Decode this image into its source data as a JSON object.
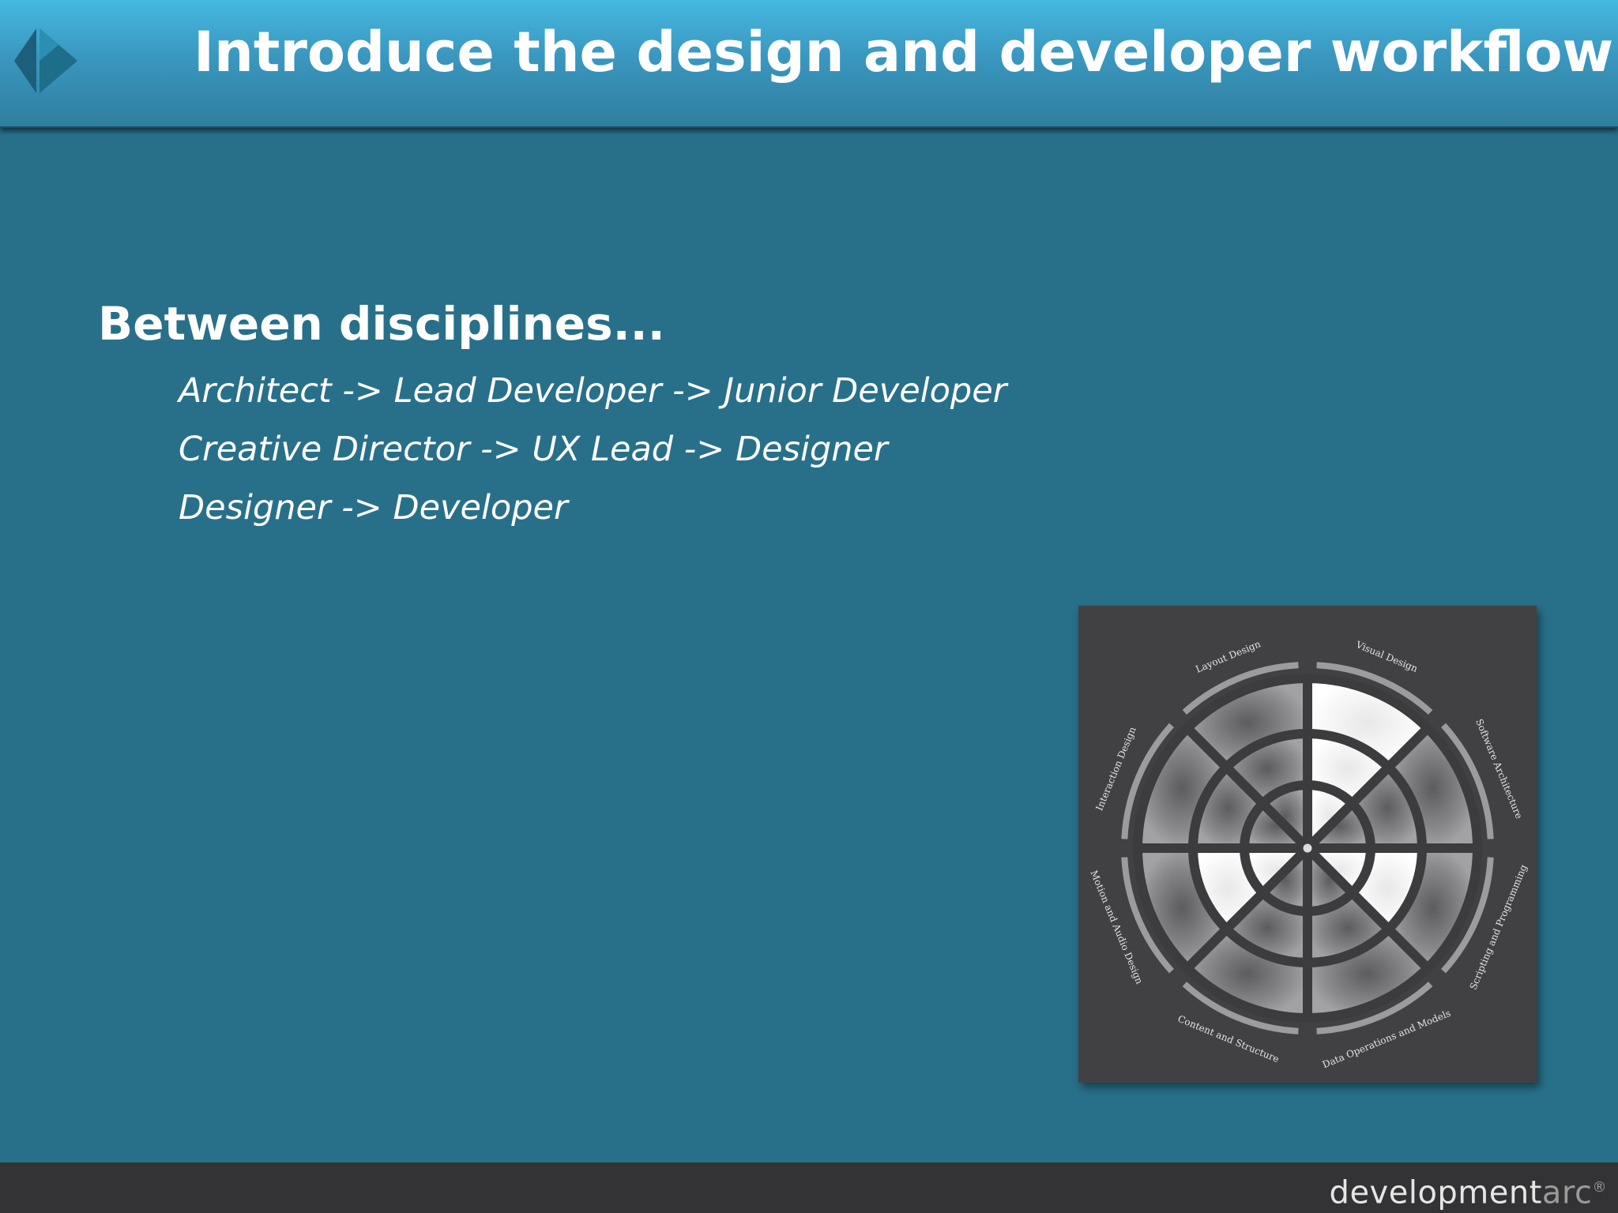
{
  "slide": {
    "title": "Introduce the design and developer workflow",
    "heading": "Between disciplines...",
    "bullets": [
      "Architect -> Lead Developer -> Junior Developer",
      "Creative Director -> UX Lead -> Designer",
      "Designer -> Developer"
    ]
  },
  "diagram": {
    "segments": [
      "Visual Design",
      "Software Architecture",
      "Scripting and Programming",
      "Data Operations and Models",
      "Content and Structure",
      "Motion and Audio Design",
      "Interaction Design",
      "Layout Design"
    ],
    "highlighted": [
      {
        "segment": "Visual Design",
        "rings": 3
      },
      {
        "segment": "Scripting and Programming",
        "rings": 2
      },
      {
        "segment": "Motion and Audio Design",
        "rings": 2
      }
    ]
  },
  "footer": {
    "brand_main": "development",
    "brand_light": "arc",
    "brand_mark": "®"
  },
  "colors": {
    "header_top": "#45b9e1",
    "background": "#287089",
    "footer": "#333335",
    "diagram_bg": "#414143"
  },
  "icons": {
    "logo": "diamond-arrow-logo"
  }
}
